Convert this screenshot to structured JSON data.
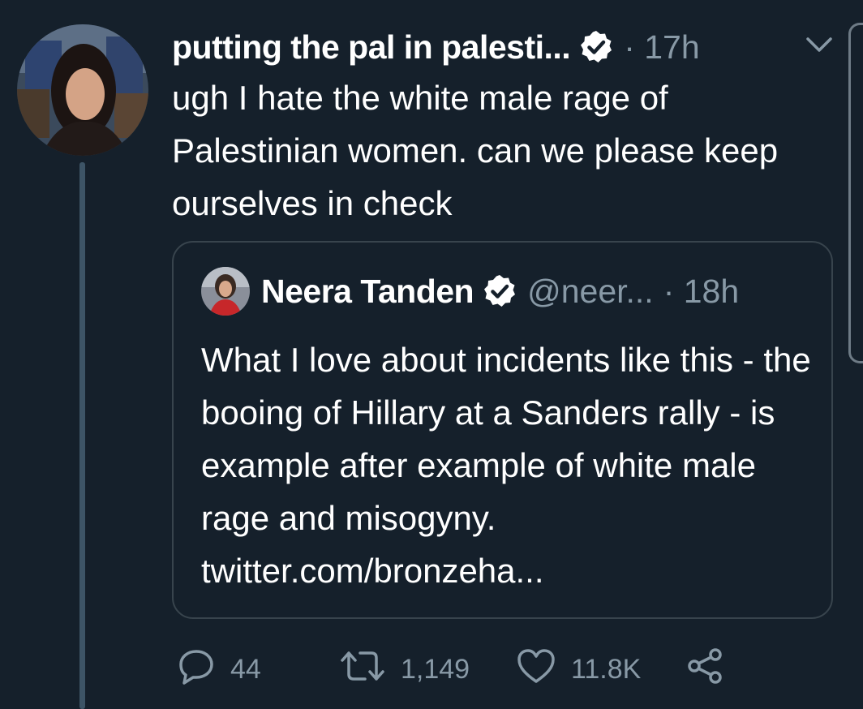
{
  "tweet": {
    "display_name": "putting the pal in palesti...",
    "timestamp": "· 17h",
    "text": "ugh I hate the white male rage of Palestinian women. can we please keep ourselves in check"
  },
  "quoted_tweet": {
    "display_name": "Neera Tanden",
    "handle": "@neer...",
    "timestamp": "· 18h",
    "text": "What I love about incidents like this - the booing of Hillary at a Sanders rally - is example after example of white male rage and misogyny. twitter.com/bronzeha..."
  },
  "actions": {
    "replies": "44",
    "retweets": "1,149",
    "likes": "11.8K"
  },
  "colors": {
    "background": "#15202b",
    "secondary_text": "#8899a6",
    "border": "#38444d",
    "thread_line": "#3d5466"
  },
  "icons": [
    "verified-icon",
    "chevron-down-icon",
    "reply-icon",
    "retweet-icon",
    "like-icon",
    "share-icon"
  ]
}
